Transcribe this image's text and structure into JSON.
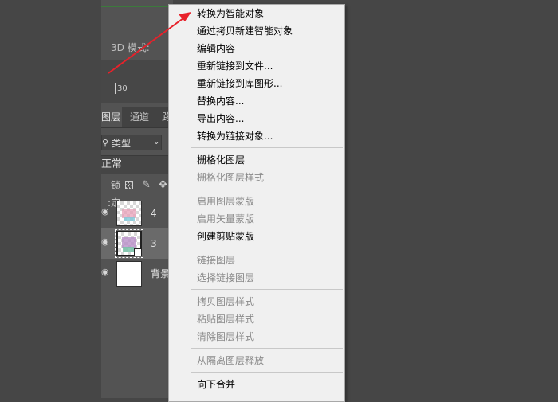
{
  "options_bar": {
    "mode_label": "3D 模式:"
  },
  "ruler": {
    "tick_label": "30"
  },
  "panel_tabs": [
    {
      "label": "图层",
      "active": true
    },
    {
      "label": "通道",
      "active": false
    },
    {
      "label": "路",
      "active": false
    }
  ],
  "filter": {
    "label": "类型"
  },
  "blend_mode": "正常",
  "lock_label": "锁定:",
  "layers": [
    {
      "name": "4",
      "selected": false
    },
    {
      "name": "3",
      "selected": true
    },
    {
      "name": "背景",
      "selected": false
    }
  ],
  "context_menu": {
    "groups": [
      [
        {
          "label": "转换为智能对象",
          "disabled": false
        },
        {
          "label": "通过拷贝新建智能对象",
          "disabled": false
        },
        {
          "label": "编辑内容",
          "disabled": false
        },
        {
          "label": "重新链接到文件...",
          "disabled": false
        },
        {
          "label": "重新链接到库图形...",
          "disabled": false
        },
        {
          "label": "替换内容...",
          "disabled": false
        },
        {
          "label": "导出内容...",
          "disabled": false
        },
        {
          "label": "转换为链接对象...",
          "disabled": false
        }
      ],
      [
        {
          "label": "栅格化图层",
          "disabled": false
        },
        {
          "label": "栅格化图层样式",
          "disabled": true
        }
      ],
      [
        {
          "label": "启用图层蒙版",
          "disabled": true
        },
        {
          "label": "启用矢量蒙版",
          "disabled": true
        },
        {
          "label": "创建剪贴蒙版",
          "disabled": false
        }
      ],
      [
        {
          "label": "链接图层",
          "disabled": true
        },
        {
          "label": "选择链接图层",
          "disabled": true
        }
      ],
      [
        {
          "label": "拷贝图层样式",
          "disabled": true
        },
        {
          "label": "粘贴图层样式",
          "disabled": true
        },
        {
          "label": "清除图层样式",
          "disabled": true
        }
      ],
      [
        {
          "label": "从隔离图层释放",
          "disabled": true
        }
      ],
      [
        {
          "label": "向下合并",
          "disabled": false
        }
      ]
    ]
  },
  "colors": {
    "arrow": "#e8212a"
  }
}
